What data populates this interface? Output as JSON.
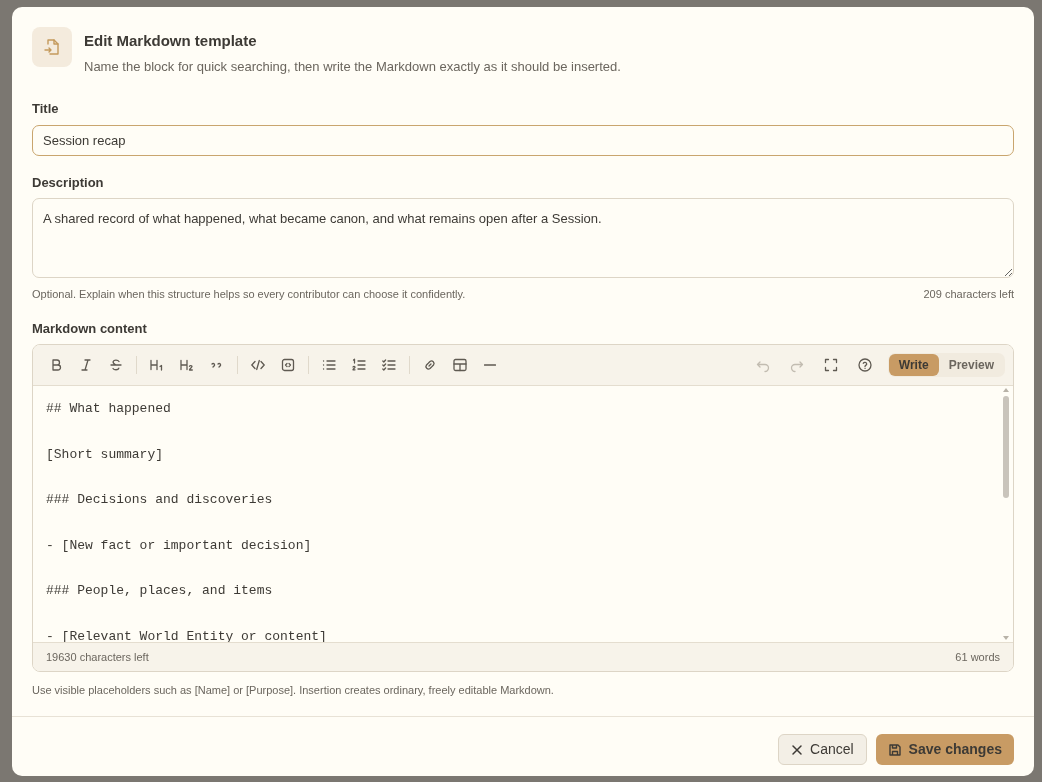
{
  "dialog": {
    "title": "Edit Markdown template",
    "subtitle": "Name the block for quick searching, then write the Markdown exactly as it should be inserted."
  },
  "title_field": {
    "label": "Title",
    "value": "Session recap",
    "focused": true
  },
  "description_field": {
    "label": "Description",
    "value": "A shared record of what happened, what became canon, and what remains open after a Session.",
    "help": "Optional. Explain when this structure helps so every contributor can choose it confidently.",
    "counter": "209 characters left"
  },
  "markdown": {
    "label": "Markdown content",
    "toolbar_groups": [
      [
        {
          "kind": "bold"
        },
        {
          "kind": "italic"
        },
        {
          "kind": "strike"
        }
      ],
      [
        {
          "kind": "h1"
        },
        {
          "kind": "h2"
        },
        {
          "kind": "quote"
        }
      ],
      [
        {
          "kind": "code"
        },
        {
          "kind": "codeblock"
        }
      ],
      [
        {
          "kind": "bullets"
        },
        {
          "kind": "numbers"
        },
        {
          "kind": "tasks"
        }
      ],
      [
        {
          "kind": "link"
        },
        {
          "kind": "table"
        },
        {
          "kind": "rule"
        }
      ]
    ],
    "right_tools": [
      {
        "kind": "undo",
        "disabled": true
      },
      {
        "kind": "redo",
        "disabled": true
      },
      {
        "kind": "fullscreen",
        "disabled": false
      },
      {
        "kind": "help",
        "disabled": false
      }
    ],
    "modes": [
      {
        "label": "Write",
        "selected": true
      },
      {
        "label": "Preview",
        "selected": false
      }
    ],
    "lines": [
      "## What happened",
      "[Short summary]",
      "### Decisions and discoveries",
      "- [New fact or important decision]",
      "### People, places, and items",
      "- [Relevant World Entity or content]"
    ],
    "chars_left": "19630 characters left",
    "words": "61 words",
    "hint": "Use visible placeholders such as [Name] or [Purpose]. Insertion creates ordinary, freely editable Markdown."
  },
  "buttons": [
    {
      "kind": "cancel",
      "label": "Cancel"
    },
    {
      "kind": "save",
      "label": "Save changes"
    }
  ]
}
